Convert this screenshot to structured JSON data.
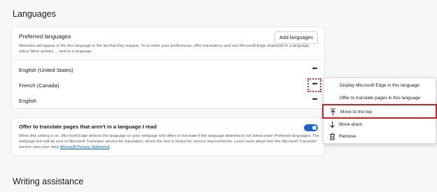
{
  "languages_section": {
    "title": "Languages",
    "preferred": {
      "title": "Preferred languages",
      "add_button": "Add languages",
      "description": "Websites will appear in the first language in the list that they support. To re-order your preferences, offer translations and see Microsoft Edge displayed in a language, select More actions ... next to a language.",
      "languages": [
        {
          "name": "English (United States)"
        },
        {
          "name": "French (Canada)"
        },
        {
          "name": "English"
        }
      ],
      "more_label": "•••"
    },
    "translate": {
      "title": "Offer to translate pages that aren't in a language I read",
      "toggle_on": true,
      "description": "When this setting is on, Microsoft Edge detects the language on your webpage and offers to translate if the language detected is not listed under Preferred languages. The webpage text will be sent to Microsoft Translator service for translation, where the text is stored for service improvements. Learn more about how the Microsoft Translator service uses your data",
      "link": "Microsoft Privacy Statement",
      "link_suffix": "."
    }
  },
  "context_menu": {
    "items": [
      {
        "label": "Display Microsoft Edge in this language",
        "icon": "none"
      },
      {
        "label": "Offer to translate pages in this language",
        "icon": "none"
      },
      {
        "label": "Move to the top",
        "icon": "move-to-top-icon",
        "highlighted": true
      },
      {
        "label": "Move down",
        "icon": "arrow-down-icon"
      },
      {
        "label": "Remove",
        "icon": "trash-icon"
      }
    ]
  },
  "writing_section": {
    "title": "Writing assistance"
  },
  "colors": {
    "accent": "#1a62d6",
    "highlight": "#d41e1e",
    "link": "#0d5ec9"
  }
}
